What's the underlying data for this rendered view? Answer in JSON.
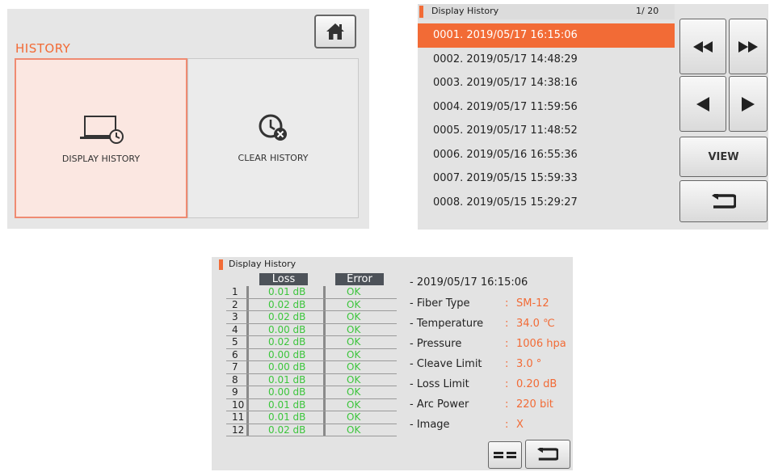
{
  "menu": {
    "title": "HISTORY",
    "tiles": [
      {
        "label": "DISPLAY HISTORY",
        "icon": "monitor-clock-icon"
      },
      {
        "label": "CLEAR HISTORY",
        "icon": "clock-delete-icon"
      }
    ],
    "home_icon": "home-icon"
  },
  "list": {
    "title": "Display History",
    "page": "1/  20",
    "rows": [
      "0001. 2019/05/17  16:15:06",
      "0002. 2019/05/17  14:48:29",
      "0003. 2019/05/17  14:38:16",
      "0004. 2019/05/17  11:59:56",
      "0005. 2019/05/17  11:48:52",
      "0006. 2019/05/16  16:55:36",
      "0007. 2019/05/15  15:59:33",
      "0008. 2019/05/15  15:29:27"
    ],
    "selected_index": 0,
    "view_label": "VIEW",
    "buttons": [
      "fast-rewind-icon",
      "fast-forward-icon",
      "prev-icon",
      "next-icon",
      "back-icon"
    ]
  },
  "detail": {
    "title": "Display History",
    "col_loss": "Loss",
    "col_error": "Error",
    "rows": [
      {
        "n": "1",
        "loss": "0.01 dB",
        "err": "OK"
      },
      {
        "n": "2",
        "loss": "0.02 dB",
        "err": "OK"
      },
      {
        "n": "3",
        "loss": "0.02 dB",
        "err": "OK"
      },
      {
        "n": "4",
        "loss": "0.00 dB",
        "err": "OK"
      },
      {
        "n": "5",
        "loss": "0.02 dB",
        "err": "OK"
      },
      {
        "n": "6",
        "loss": "0.00 dB",
        "err": "OK"
      },
      {
        "n": "7",
        "loss": "0.00 dB",
        "err": "OK"
      },
      {
        "n": "8",
        "loss": "0.01 dB",
        "err": "OK"
      },
      {
        "n": "9",
        "loss": "0.00 dB",
        "err": "OK"
      },
      {
        "n": "10",
        "loss": "0.01 dB",
        "err": "OK"
      },
      {
        "n": "11",
        "loss": "0.01 dB",
        "err": "OK"
      },
      {
        "n": "12",
        "loss": "0.02 dB",
        "err": "OK"
      }
    ],
    "timestamp": "- 2019/05/17 16:15:06",
    "info": [
      {
        "k": "- Fiber Type",
        "v": "SM-12"
      },
      {
        "k": "- Temperature",
        "v": "34.0 ℃"
      },
      {
        "k": "- Pressure",
        "v": "1006 hpa"
      },
      {
        "k": "- Cleave Limit",
        "v": "3.0 °"
      },
      {
        "k": "- Loss Limit",
        "v": "0.20 dB"
      },
      {
        "k": "- Arc Power",
        "v": "220 bit"
      },
      {
        "k": "- Image",
        "v": "X"
      }
    ],
    "buttons": [
      "fiber-image-icon",
      "back-icon"
    ]
  },
  "colors": {
    "accent": "#f26b36",
    "ok_green": "#3cc53c",
    "panel": "#e3e3e3"
  }
}
